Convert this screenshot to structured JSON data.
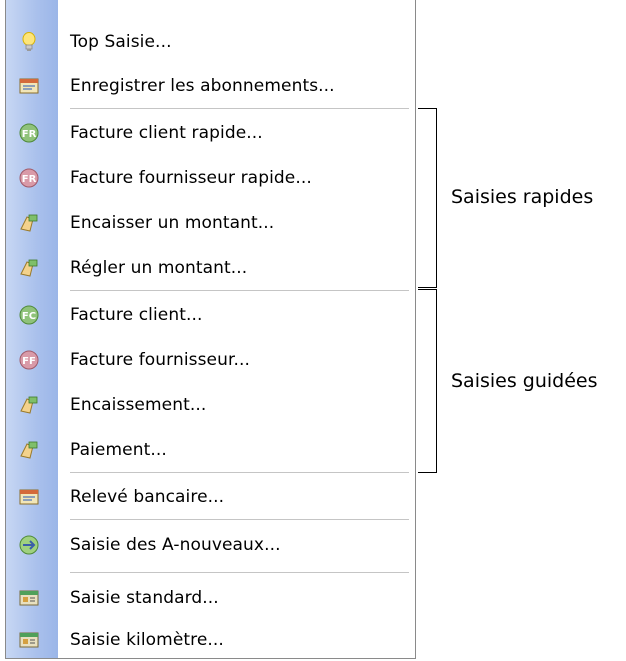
{
  "menu": {
    "items": [
      {
        "label": "Top Saisie...",
        "icon": "lightbulb-icon"
      },
      {
        "label": "Enregistrer les abonnements...",
        "icon": "journal-icon"
      },
      {
        "label": "Facture client rapide...",
        "icon": "fast-invoice-icon"
      },
      {
        "label": "Facture fournisseur rapide...",
        "icon": "fast-invoice-icon"
      },
      {
        "label": "Encaisser un montant...",
        "icon": "payment-hand-icon"
      },
      {
        "label": "Régler un montant...",
        "icon": "payment-hand-icon"
      },
      {
        "label": "Facture client...",
        "icon": "invoice-icon"
      },
      {
        "label": "Facture fournisseur...",
        "icon": "invoice-icon"
      },
      {
        "label": "Encaissement...",
        "icon": "payment-hand-icon"
      },
      {
        "label": "Paiement...",
        "icon": "payment-hand-icon"
      },
      {
        "label": "Relevé bancaire...",
        "icon": "journal-icon"
      },
      {
        "label": "Saisie des A-nouveaux...",
        "icon": "carry-forward-icon"
      },
      {
        "label": "Saisie standard...",
        "icon": "ledger-icon"
      },
      {
        "label": "Saisie kilomètre...",
        "icon": "ledger-icon"
      }
    ]
  },
  "annotations": {
    "rapides_label": "Saisies rapides",
    "guidees_label": "Saisies guidées"
  },
  "colors": {
    "gutter": "#a9c0ec",
    "border": "#8a8a8a",
    "separator": "#c5c5c5"
  }
}
